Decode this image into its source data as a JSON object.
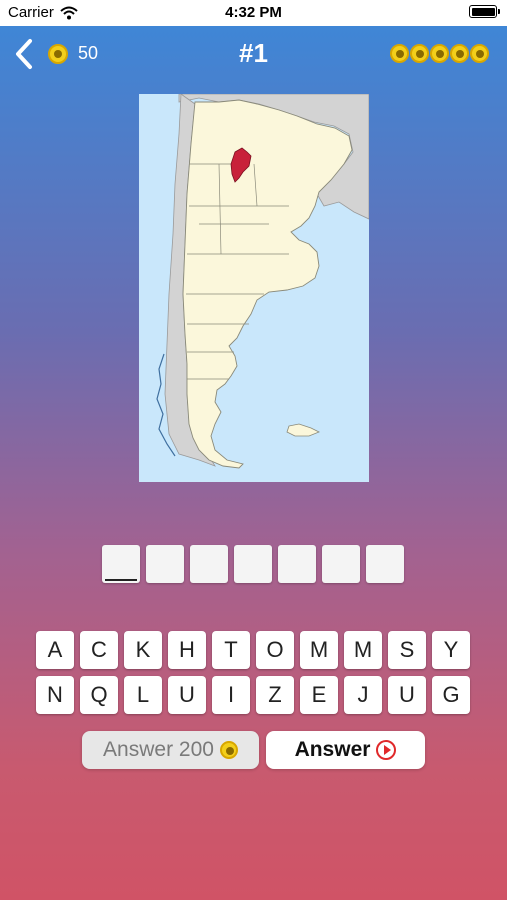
{
  "status": {
    "carrier": "Carrier",
    "time": "4:32 PM"
  },
  "header": {
    "coins": "50",
    "level": "#1",
    "hint_coins": 5
  },
  "map": {
    "highlight_color": "#c8213a",
    "land_color": "#fbf7db",
    "neighbor_color": "#d3d3d3",
    "sea_color": "#c9e7fb"
  },
  "answer": {
    "slots": [
      "",
      "",
      "",
      "",
      "",
      "",
      ""
    ]
  },
  "keyboard": {
    "row1": [
      "A",
      "C",
      "K",
      "H",
      "T",
      "O",
      "M",
      "M",
      "S",
      "Y"
    ],
    "row2": [
      "N",
      "Q",
      "L",
      "U",
      "I",
      "Z",
      "E",
      "J",
      "U",
      "G"
    ]
  },
  "buttons": {
    "hint_label": "Answer 200",
    "answer_label": "Answer"
  }
}
